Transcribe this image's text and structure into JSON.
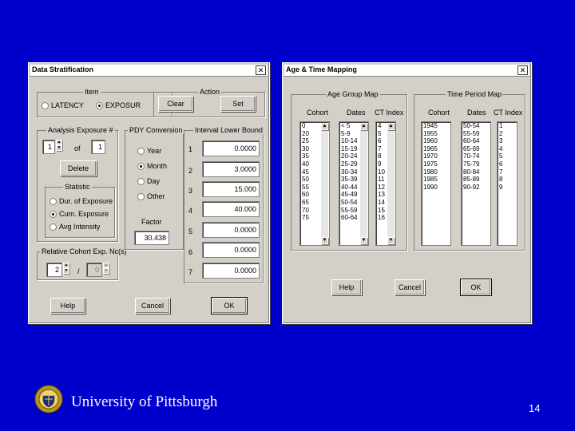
{
  "colors": {
    "slide_bg": "#0000cc",
    "dialog_bg": "#d4d0c8"
  },
  "dialog1": {
    "title": "Data Stratification",
    "item_group": {
      "label": "Item",
      "options": [
        "LATENCY",
        "EXPOSUR"
      ],
      "selected": "EXPOSUR"
    },
    "action_group": {
      "label": "Action",
      "clear": "Clear",
      "set": "Set"
    },
    "analysis_group": {
      "label": "Analysis Exposure #",
      "value1": "1",
      "of": "of",
      "value2": "1",
      "delete": "Delete"
    },
    "statistic_group": {
      "label": "Statistic",
      "options": [
        "Dur. of Exposure",
        "Cum. Exposure",
        "Avg Intensity"
      ],
      "selected": "Cum. Exposure"
    },
    "relative_group": {
      "label": "Relative Cohort Exp. Nc(s)",
      "value1": "2",
      "slash": "/",
      "value2": "0"
    },
    "pdy_group": {
      "label": "PDY Conversion",
      "options": [
        "Year",
        "Month",
        "Day",
        "Other"
      ],
      "selected": "Month",
      "factor_label": "Factor",
      "factor_value": "30.438"
    },
    "interval_group": {
      "label": "Interval Lower Bound",
      "rows": [
        {
          "num": "1",
          "value": "0.0000"
        },
        {
          "num": "2",
          "value": "3.0000"
        },
        {
          "num": "3",
          "value": "15.000"
        },
        {
          "num": "4",
          "value": "40.000"
        },
        {
          "num": "5",
          "value": "0.0000"
        },
        {
          "num": "6",
          "value": "0.0000"
        },
        {
          "num": "7",
          "value": "0.0000"
        }
      ]
    },
    "buttons": {
      "help": "Help",
      "cancel": "Cancel",
      "ok": "OK"
    }
  },
  "dialog2": {
    "title": "Age & Time Mapping",
    "age_group": {
      "label": "Age Group Map",
      "cohort_header": "Cohort",
      "dates_header": "Dates",
      "ctindex_header": "CT Index",
      "cohort": [
        "0",
        "20",
        "25",
        "30",
        "35",
        "40",
        "45",
        "50",
        "55",
        "60",
        "65",
        "70",
        "75"
      ],
      "dates": [
        "< 5",
        "5-9",
        "10-14",
        "15-19",
        "20-24",
        "25-29",
        "30-34",
        "35-39",
        "40-44",
        "45-49",
        "50-54",
        "55-59",
        "60-64"
      ],
      "ctindex": [
        "4",
        "5",
        "6",
        "7",
        "8",
        "9",
        "10",
        "11",
        "12",
        "13",
        "14",
        "15",
        "16"
      ]
    },
    "time_group": {
      "label": "Time Period Map",
      "cohort_header": "Cohort",
      "dates_header": "Dates",
      "ctindex_header": "CT Index",
      "cohort": [
        "1945",
        "1955",
        "1960",
        "1965",
        "1970",
        "1975",
        "1980",
        "1985",
        "1990"
      ],
      "dates": [
        "50-54",
        "55-59",
        "60-64",
        "65-69",
        "70-74",
        "75-79",
        "80-84",
        "85-89",
        "90-92"
      ],
      "ctindex": [
        "1",
        "2",
        "3",
        "4",
        "5",
        "6",
        "7",
        "8",
        "9"
      ]
    },
    "buttons": {
      "help": "Help",
      "cancel": "Cancel",
      "ok": "OK"
    }
  },
  "footer": {
    "university": "University of Pittsburgh",
    "slide_number": "14",
    "seal_icon": "university-seal-icon"
  }
}
